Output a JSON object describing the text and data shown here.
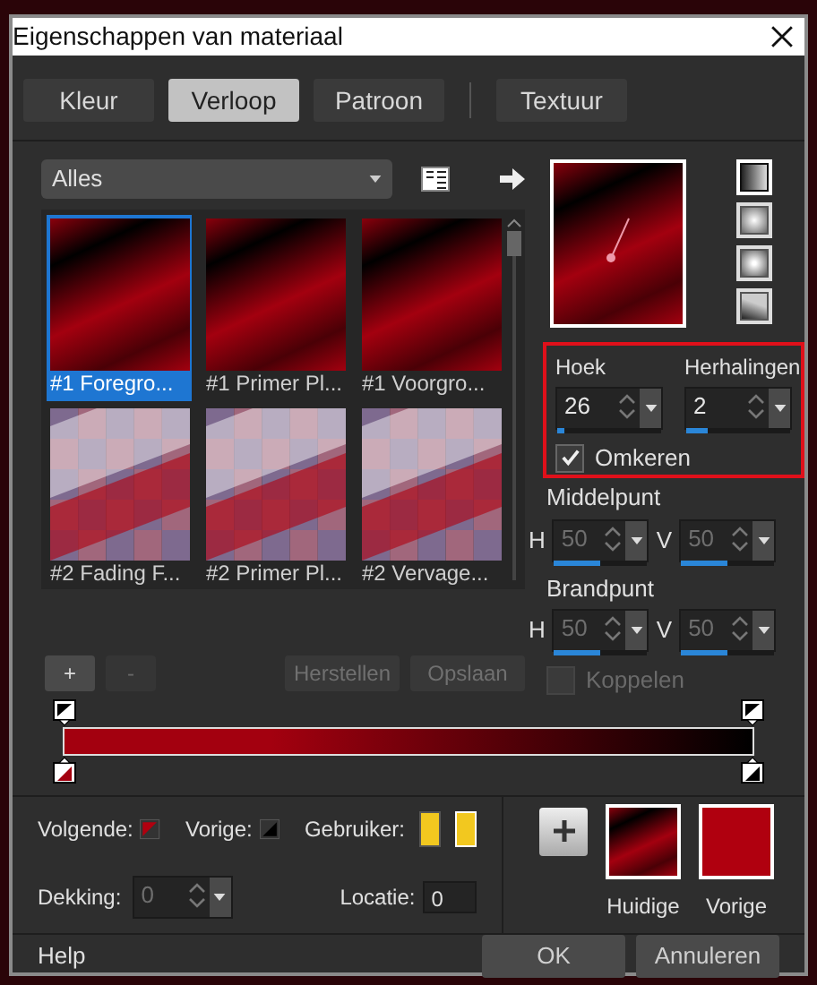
{
  "window": {
    "title": "Eigenschappen van materiaal"
  },
  "tabs": [
    {
      "label": "Kleur",
      "selected": false
    },
    {
      "label": "Verloop",
      "selected": true
    },
    {
      "label": "Patroon",
      "selected": false
    },
    {
      "label": "Textuur",
      "selected": false
    }
  ],
  "category_select": {
    "value": "Alles"
  },
  "presets": [
    {
      "label": "#1 Foregro...",
      "selected": true,
      "kind": "linear"
    },
    {
      "label": "#1 Primer Pl...",
      "selected": false,
      "kind": "linear"
    },
    {
      "label": "#1 Voorgro...",
      "selected": false,
      "kind": "linear"
    },
    {
      "label": "#2 Fading F...",
      "selected": false,
      "kind": "checker"
    },
    {
      "label": "#2 Primer Pl...",
      "selected": false,
      "kind": "checker"
    },
    {
      "label": "#2 Vervage...",
      "selected": false,
      "kind": "checker"
    }
  ],
  "gradient_styles": [
    {
      "kind": "linear",
      "selected": true
    },
    {
      "kind": "rectangular",
      "selected": false
    },
    {
      "kind": "radial",
      "selected": false
    },
    {
      "kind": "corner",
      "selected": false
    }
  ],
  "angle": {
    "label": "Hoek",
    "value": "26",
    "level": 0.07,
    "disabled": false
  },
  "repeats": {
    "label": "Herhalingen",
    "value": "2",
    "level": 0.2,
    "disabled": false
  },
  "reverse": {
    "label": "Omkeren",
    "checked": true
  },
  "center": {
    "label": "Middelpunt",
    "fields": [
      {
        "label": "H",
        "value": "50",
        "level": 0.5,
        "disabled": true
      },
      {
        "label": "V",
        "value": "50",
        "level": 0.5,
        "disabled": true
      }
    ]
  },
  "focus": {
    "label": "Brandpunt",
    "fields": [
      {
        "label": "H",
        "value": "50",
        "level": 0.5,
        "disabled": true
      },
      {
        "label": "V",
        "value": "50",
        "level": 0.5,
        "disabled": true
      }
    ]
  },
  "link": {
    "label": "Koppelen",
    "checked": false,
    "disabled": true
  },
  "stop_buttons": [
    {
      "label": "+",
      "disabled": false
    },
    {
      "label": "-",
      "disabled": true
    }
  ],
  "edit_buttons": [
    {
      "label": "Herstellen",
      "disabled": true
    },
    {
      "label": "Opslaan",
      "disabled": true
    }
  ],
  "gradient_bar": {
    "stops": [
      {
        "color": "#a3000f"
      },
      {
        "color": "#000000"
      }
    ]
  },
  "stop_colors": [
    {
      "label": "Volgende:",
      "kind": "foreground"
    },
    {
      "label": "Vorige:",
      "kind": "background"
    },
    {
      "label": "Gebruiker:",
      "kind": "user"
    }
  ],
  "user_colors": [
    {
      "color": "#f2c81f",
      "selected": false
    },
    {
      "color": "#f2c81f",
      "selected": true
    }
  ],
  "opacity": {
    "label": "Dekking:",
    "value": "0",
    "disabled": true
  },
  "location": {
    "label": "Locatie:",
    "value": "0"
  },
  "swatches": [
    {
      "label": "Huidige",
      "kind": "gradient"
    },
    {
      "label": "Vorige",
      "kind": "solid",
      "color": "#b0000f"
    }
  ],
  "footer": {
    "help": "Help",
    "buttons": [
      "OK",
      "Annuleren"
    ]
  }
}
